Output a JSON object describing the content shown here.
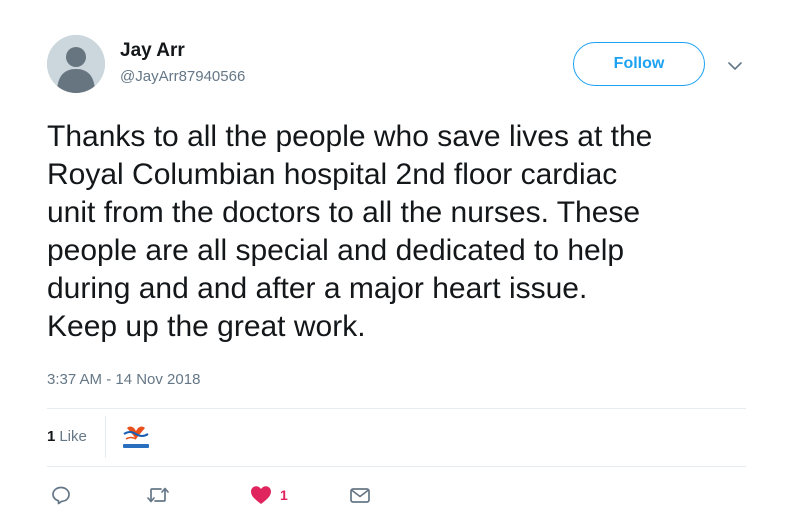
{
  "author": {
    "name": "Jay Arr",
    "handle": "@JayArr87940566"
  },
  "follow_button": {
    "label": "Follow"
  },
  "tweet": {
    "lines": [
      "Thanks to all the people who save lives at the",
      "Royal Columbian hospital 2nd floor cardiac",
      "unit from the doctors to all the nurses. These",
      "people are all special and dedicated to help",
      "during and and after a major heart issue.",
      "Keep up the great work."
    ],
    "timestamp": "3:37 AM - 14 Nov 2018"
  },
  "stats": {
    "likes_count": "1",
    "likes_label": "Like"
  },
  "actions": {
    "reply_icon": "reply-icon",
    "retweet_icon": "retweet-icon",
    "like_icon": "heart-icon",
    "like_count": "1",
    "dm_icon": "envelope-icon"
  },
  "colors": {
    "accent": "#1da1f2",
    "like": "#e0245e",
    "muted": "#657786",
    "text": "#14171a",
    "divider": "#e6ecf0"
  }
}
